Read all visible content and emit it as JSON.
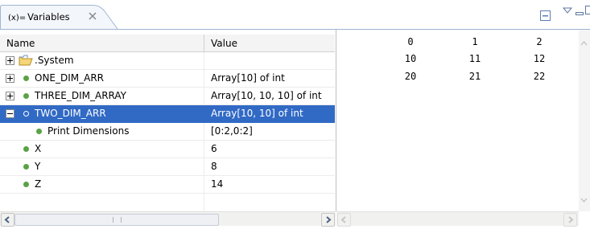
{
  "tab": {
    "title": "Variables",
    "title_prefix": "(x)="
  },
  "toolbar": {
    "buttons": [
      "collapse-all-icon",
      "view-menu-icon",
      "minimize-icon",
      "maximize-icon"
    ]
  },
  "columns": {
    "name": "Name",
    "value": "Value"
  },
  "rows": [
    {
      "name": ".System",
      "value": "",
      "icon": "folder-icon",
      "expander": "collapsed"
    },
    {
      "name": "ONE_DIM_ARR",
      "value": "Array[10] of int",
      "icon": "variable-icon",
      "expander": "collapsed"
    },
    {
      "name": "THREE_DIM_ARRAY",
      "value": "Array[10, 10, 10] of int",
      "icon": "variable-icon",
      "expander": "collapsed"
    },
    {
      "name": "TWO_DIM_ARR",
      "value": "Array[10, 10] of int",
      "icon": "variable-icon",
      "expander": "expanded",
      "selected": true
    },
    {
      "name": "Print Dimensions",
      "value": "[0:2,0:2]",
      "icon": "variable-icon",
      "child": true
    },
    {
      "name": "X",
      "value": "6",
      "icon": "variable-icon"
    },
    {
      "name": "Y",
      "value": "8",
      "icon": "variable-icon"
    },
    {
      "name": "Z",
      "value": "14",
      "icon": "variable-icon"
    }
  ],
  "detail": {
    "values": [
      [
        "0",
        "1",
        "2"
      ],
      [
        "10",
        "11",
        "12"
      ],
      [
        "20",
        "21",
        "22"
      ]
    ]
  },
  "colors": {
    "selection": "#316ac5",
    "variable_dot": "#59a245",
    "folder": "#e8c25b"
  }
}
